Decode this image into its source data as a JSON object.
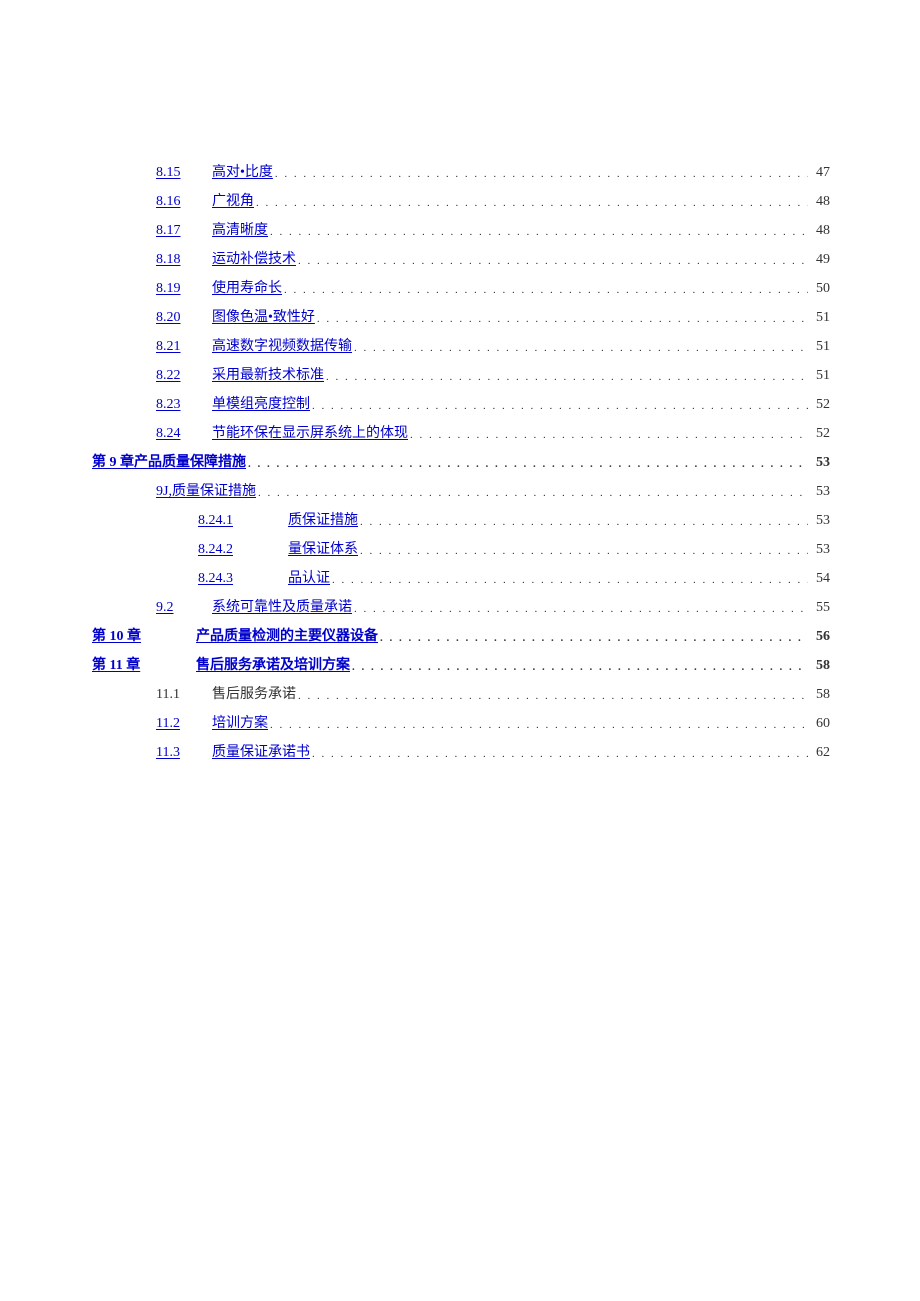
{
  "toc": [
    {
      "indent": 64,
      "numWidth": 56,
      "num": "8.15",
      "title": "高对•比度",
      "page": "47",
      "link": true,
      "bold": false
    },
    {
      "indent": 64,
      "numWidth": 56,
      "num": "8.16",
      "title": "广视角",
      "page": "48",
      "link": true,
      "bold": false
    },
    {
      "indent": 64,
      "numWidth": 56,
      "num": "8.17",
      "title": "高清晰度",
      "page": "48",
      "link": true,
      "bold": false
    },
    {
      "indent": 64,
      "numWidth": 56,
      "num": "8.18",
      "title": "运动补偿技术",
      "page": "49",
      "link": true,
      "bold": false
    },
    {
      "indent": 64,
      "numWidth": 56,
      "num": "8.19",
      "title": "使用寿命长",
      "page": "50",
      "link": true,
      "bold": false
    },
    {
      "indent": 64,
      "numWidth": 56,
      "num": "8.20",
      "title": "图像色温•致性好",
      "page": "51",
      "link": true,
      "bold": false
    },
    {
      "indent": 64,
      "numWidth": 56,
      "num": "8.21",
      "title": "高速数字视频数据传输",
      "page": "51",
      "link": true,
      "bold": false
    },
    {
      "indent": 64,
      "numWidth": 56,
      "num": "8.22",
      "title": "采用最新技术标准",
      "page": "51",
      "link": true,
      "bold": false
    },
    {
      "indent": 64,
      "numWidth": 56,
      "num": "8.23",
      "title": "单模组亮度控制",
      "page": "52",
      "link": true,
      "bold": false
    },
    {
      "indent": 64,
      "numWidth": 56,
      "num": "8.24",
      "title": "节能环保在显示屏系统上的体现",
      "page": "52",
      "link": true,
      "bold": false
    },
    {
      "indent": 0,
      "numWidth": 0,
      "num": "",
      "title": "第 9 章产品质量保障措施",
      "page": "53",
      "link": true,
      "bold": true
    },
    {
      "indent": 64,
      "numWidth": 0,
      "num": "",
      "title": "9J,质量保证措施",
      "page": "53",
      "link": true,
      "bold": false
    },
    {
      "indent": 106,
      "numWidth": 90,
      "num": "8.24.1",
      "title": "质保证措施",
      "page": "53",
      "link": true,
      "bold": false
    },
    {
      "indent": 106,
      "numWidth": 90,
      "num": "8.24.2",
      "title": "量保证体系",
      "page": "53",
      "link": true,
      "bold": false
    },
    {
      "indent": 106,
      "numWidth": 90,
      "num": "8.24.3",
      "title": "品认证",
      "page": "54",
      "link": true,
      "bold": false
    },
    {
      "indent": 64,
      "numWidth": 56,
      "num": "9.2",
      "title": "系统可靠性及质量承诺",
      "page": "55",
      "link": true,
      "bold": false
    },
    {
      "indent": 0,
      "numWidth": 104,
      "num": "第 10 章",
      "title": "产品质量检测的主要仪器设备",
      "page": "56",
      "link": true,
      "bold": true
    },
    {
      "indent": 0,
      "numWidth": 104,
      "num": "第 11 章",
      "title": "售后服务承诺及培训方案",
      "page": "58",
      "link": true,
      "bold": true
    },
    {
      "indent": 64,
      "numWidth": 56,
      "num": "11.1",
      "title": "售后服务承诺",
      "page": "58",
      "link": false,
      "bold": false
    },
    {
      "indent": 64,
      "numWidth": 56,
      "num": "11.2",
      "title": "培训方案",
      "page": "60",
      "link": true,
      "bold": false
    },
    {
      "indent": 64,
      "numWidth": 56,
      "num": "11.3",
      "title": "质量保证承诺书",
      "page": "62",
      "link": true,
      "bold": false
    }
  ]
}
